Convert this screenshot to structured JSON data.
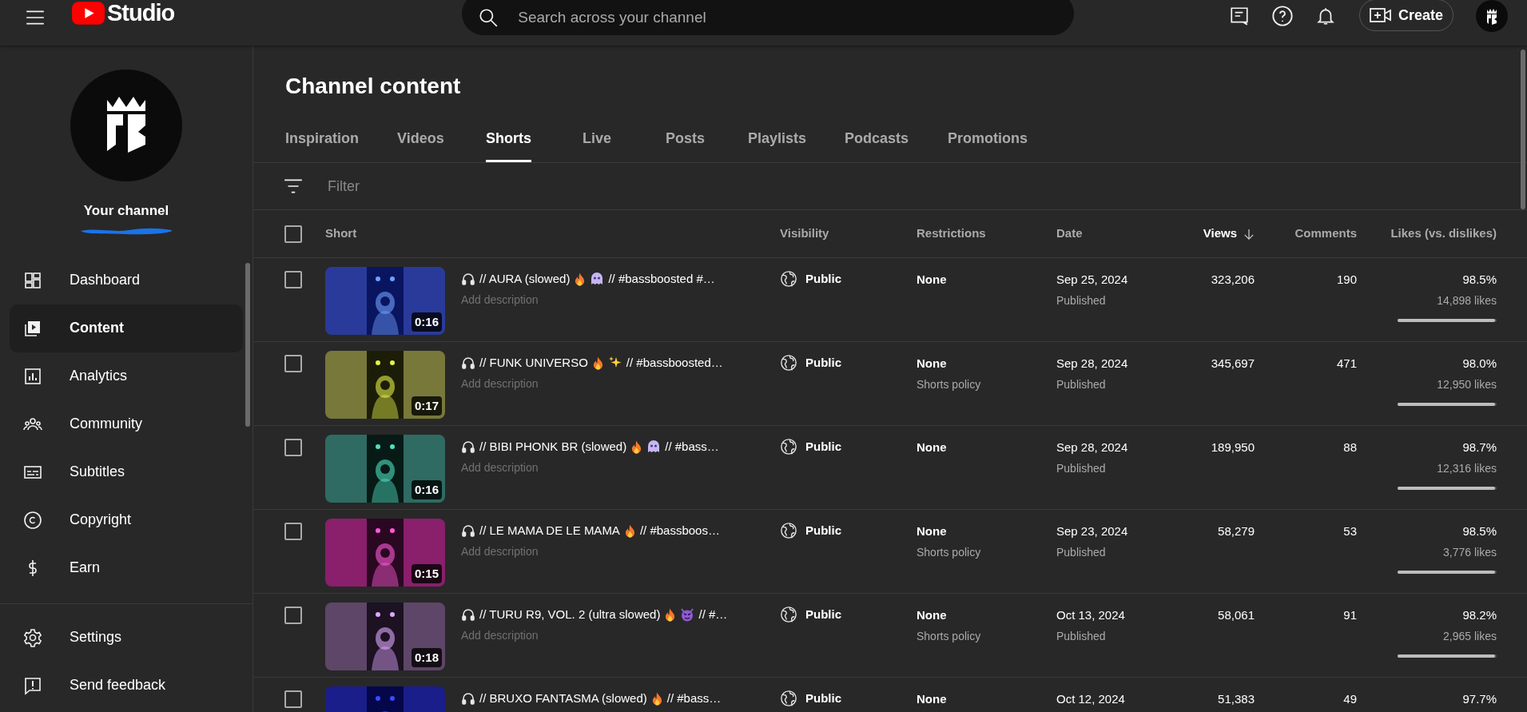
{
  "topbar": {
    "logo_text": "Studio",
    "search": {
      "placeholder": "Search across your channel"
    },
    "create_button": "Create"
  },
  "sidebar": {
    "channel_label": "Your channel",
    "items": [
      {
        "label": "Dashboard",
        "kind": "dashboard",
        "selected": false
      },
      {
        "label": "Content",
        "kind": "content",
        "selected": true
      },
      {
        "label": "Analytics",
        "kind": "analytics",
        "selected": false
      },
      {
        "label": "Community",
        "kind": "community",
        "selected": false
      },
      {
        "label": "Subtitles",
        "kind": "subtitles",
        "selected": false
      },
      {
        "label": "Copyright",
        "kind": "copyright",
        "selected": false
      },
      {
        "label": "Earn",
        "kind": "earn",
        "selected": false
      }
    ],
    "footer_items": [
      {
        "label": "Settings",
        "kind": "settings"
      },
      {
        "label": "Send feedback",
        "kind": "feedback"
      }
    ]
  },
  "page_title": "Channel content",
  "tabs": [
    {
      "label": "Inspiration",
      "selected": false
    },
    {
      "label": "Videos",
      "selected": false
    },
    {
      "label": "Shorts",
      "selected": true
    },
    {
      "label": "Live",
      "selected": false
    },
    {
      "label": "Posts",
      "selected": false
    },
    {
      "label": "Playlists",
      "selected": false
    },
    {
      "label": "Podcasts",
      "selected": false
    },
    {
      "label": "Promotions",
      "selected": false
    }
  ],
  "filter": {
    "placeholder": "Filter"
  },
  "table": {
    "select_all": {
      "checked": false
    },
    "columns": [
      {
        "label": "Short",
        "sorted": false
      },
      {
        "label": "Visibility",
        "sorted": false
      },
      {
        "label": "Restrictions",
        "sorted": false
      },
      {
        "label": "Date",
        "sorted": false
      },
      {
        "label": "Views",
        "sorted": true
      },
      {
        "label": "Comments",
        "sorted": false
      },
      {
        "label": "Likes (vs. dislikes)",
        "sorted": false
      }
    ],
    "rows": [
      {
        "checked": false,
        "duration": "0:16",
        "title": [
          {
            "kind": "headphones"
          },
          {
            "kind": "text",
            "text": "// AURA (slowed)"
          },
          {
            "kind": "fire"
          },
          {
            "kind": "ghost"
          },
          {
            "kind": "text",
            "text": "// #bassboosted #…"
          }
        ],
        "description": "Add description",
        "visibility": "Public",
        "restriction": "None",
        "date": "Sep 25, 2024",
        "date_status": "Published",
        "views": "323,206",
        "comments": "190",
        "likes_pct": "98.5%",
        "likes": "14,898 likes",
        "level": 0.985
      },
      {
        "checked": false,
        "duration": "0:17",
        "title": [
          {
            "kind": "headphones"
          },
          {
            "kind": "text",
            "text": "// FUNK UNIVERSO"
          },
          {
            "kind": "fire"
          },
          {
            "kind": "sparkles"
          },
          {
            "kind": "text",
            "text": "// #bassboosted…"
          }
        ],
        "description": "Add description",
        "visibility": "Public",
        "restriction": "None",
        "restriction_note": "Shorts policy",
        "date": "Sep 28, 2024",
        "date_status": "Published",
        "views": "345,697",
        "comments": "471",
        "likes_pct": "98.0%",
        "likes": "12,950 likes",
        "level": 0.98
      },
      {
        "checked": false,
        "duration": "0:16",
        "title": [
          {
            "kind": "headphones"
          },
          {
            "kind": "text",
            "text": "// BIBI PHONK BR (slowed)"
          },
          {
            "kind": "fire"
          },
          {
            "kind": "ghost"
          },
          {
            "kind": "text",
            "text": "// #bass…"
          }
        ],
        "description": "Add description",
        "visibility": "Public",
        "restriction": "None",
        "date": "Sep 28, 2024",
        "date_status": "Published",
        "views": "189,950",
        "comments": "88",
        "likes_pct": "98.7%",
        "likes": "12,316 likes",
        "level": 0.987
      },
      {
        "checked": false,
        "duration": "0:15",
        "title": [
          {
            "kind": "headphones"
          },
          {
            "kind": "text",
            "text": "// LE MAMA DE LE MAMA"
          },
          {
            "kind": "fire"
          },
          {
            "kind": "text",
            "text": "// #bassboos…"
          }
        ],
        "description": "Add description",
        "visibility": "Public",
        "restriction": "None",
        "restriction_note": "Shorts policy",
        "date": "Sep 23, 2024",
        "date_status": "Published",
        "views": "58,279",
        "comments": "53",
        "likes_pct": "98.5%",
        "likes": "3,776 likes",
        "level": 0.985
      },
      {
        "checked": false,
        "duration": "0:18",
        "title": [
          {
            "kind": "headphones"
          },
          {
            "kind": "text",
            "text": "// TURU R9, VOL. 2 (ultra slowed)"
          },
          {
            "kind": "fire"
          },
          {
            "kind": "devil"
          },
          {
            "kind": "text",
            "text": "// #…"
          }
        ],
        "description": "Add description",
        "visibility": "Public",
        "restriction": "None",
        "restriction_note": "Shorts policy",
        "date": "Oct 13, 2024",
        "date_status": "Published",
        "views": "58,061",
        "comments": "91",
        "likes_pct": "98.2%",
        "likes": "2,965 likes",
        "level": 0.982
      },
      {
        "checked": false,
        "title": [
          {
            "kind": "headphones"
          },
          {
            "kind": "text",
            "text": "// BRUXO FANTASMA (slowed)"
          },
          {
            "kind": "fire"
          },
          {
            "kind": "text",
            "text": "// #bass…"
          }
        ],
        "visibility": "Public",
        "restriction": "None",
        "date": "Oct 12, 2024",
        "views": "51,383",
        "comments": "49",
        "likes_pct": "97.7%"
      }
    ]
  }
}
